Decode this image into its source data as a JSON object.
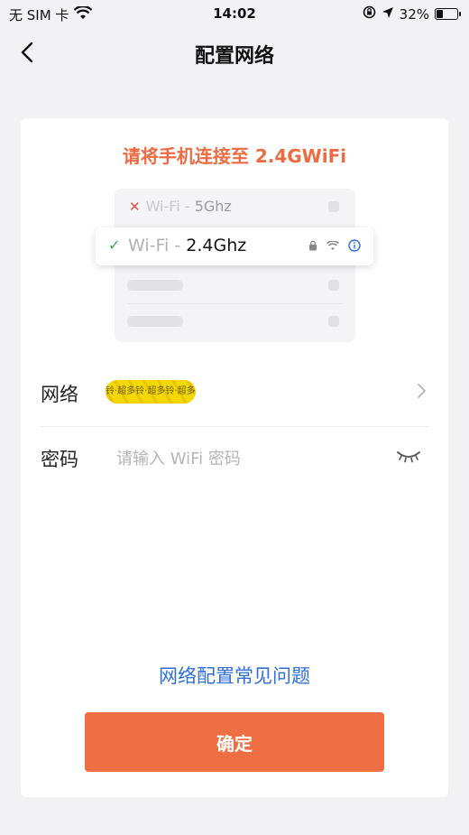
{
  "status_bar": {
    "carrier": "无 SIM 卡",
    "time": "14:02",
    "battery": "32%",
    "battery_level": 0.32
  },
  "nav": {
    "title": "配置网络"
  },
  "instruction": "请将手机连接至 2.4GWiFi",
  "illustration": {
    "wifi_5g_prefix": "Wi-Fi - ",
    "wifi_5g_band": "5Ghz",
    "wifi_24g_prefix": "Wi-Fi - ",
    "wifi_24g_band": "2.4Ghz"
  },
  "form": {
    "network_label": "网络",
    "network_value": "铃·超多铃·超多铃·超多铃",
    "password_label": "密码",
    "password_placeholder": "请输入 WiFi 密码"
  },
  "faq_link": "网络配置常见问题",
  "confirm_button": "确定",
  "colors": {
    "accent": "#ef6f45",
    "instruction": "#ec6b43",
    "link": "#2f6fd6"
  }
}
